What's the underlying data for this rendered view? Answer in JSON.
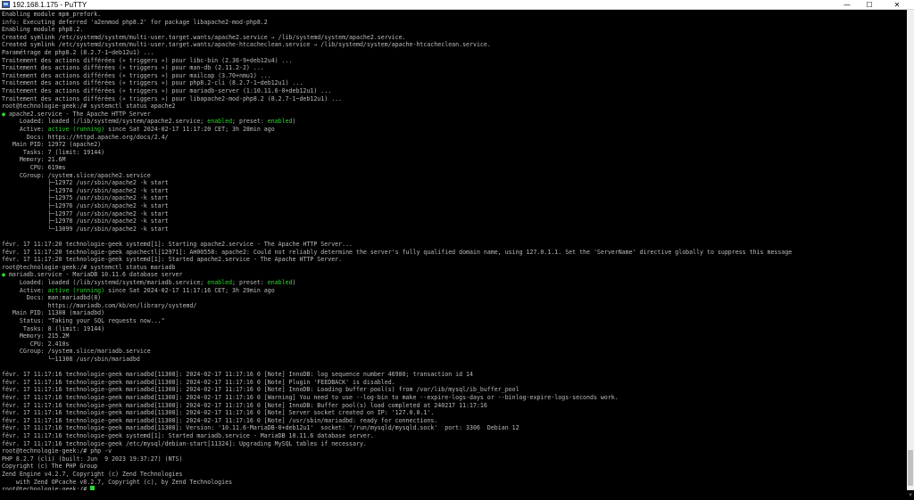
{
  "window": {
    "title": "192.168.1.175 - PuTTY",
    "controls": {
      "minimize": "—",
      "maximize": "☐",
      "close": "✕"
    }
  },
  "terminal": {
    "lines": [
      [
        {
          "t": "Enabling module mpm_prefork."
        }
      ],
      [
        {
          "t": "info: Executing deferred 'a2enmod php8.2' for package libapache2-mod-php8.2"
        }
      ],
      [
        {
          "t": "Enabling module php8.2."
        }
      ],
      [
        {
          "t": "Created symlink /etc/systemd/system/multi-user.target.wants/apache2.service → /lib/systemd/system/apache2.service."
        }
      ],
      [
        {
          "t": "Created symlink /etc/systemd/system/multi-user.target.wants/apache-htcacheclean.service → /lib/systemd/system/apache-htcacheclean.service."
        }
      ],
      [
        {
          "t": "Paramétrage de php8.2 (8.2.7-1~deb12u1) ..."
        }
      ],
      [
        {
          "t": "Traitement des actions différées (« triggers ») pour libc-bin (2.36-9+deb12u4) ..."
        }
      ],
      [
        {
          "t": "Traitement des actions différées (« triggers ») pour man-db (2.11.2-2) ..."
        }
      ],
      [
        {
          "t": "Traitement des actions différées (« triggers ») pour mailcap (3.70+nmu1) ..."
        }
      ],
      [
        {
          "t": "Traitement des actions différées (« triggers ») pour php8.2-cli (8.2.7-1~deb12u1) ..."
        }
      ],
      [
        {
          "t": "Traitement des actions différées (« triggers ») pour mariadb-server (1:10.11.6-0+deb12u1) ..."
        }
      ],
      [
        {
          "t": "Traitement des actions différées (« triggers ») pour libapache2-mod-php8.2 (8.2.7-1~deb12u1) ..."
        }
      ],
      [
        {
          "t": "root@technologie-geek:/# systemctl status apache2"
        }
      ],
      [
        {
          "t": "●",
          "c": "g"
        },
        {
          "t": " apache2.service - The Apache HTTP Server"
        }
      ],
      [
        {
          "t": "     Loaded: loaded (/lib/systemd/system/apache2.service; "
        },
        {
          "t": "enabled",
          "c": "g"
        },
        {
          "t": "; preset: "
        },
        {
          "t": "enabled",
          "c": "g"
        },
        {
          "t": ")"
        }
      ],
      [
        {
          "t": "     Active: "
        },
        {
          "t": "active (running)",
          "c": "g"
        },
        {
          "t": " since Sat 2024-02-17 11:17:20 CET; 3h 28min ago"
        }
      ],
      [
        {
          "t": "       Docs: https://httpd.apache.org/docs/2.4/"
        }
      ],
      [
        {
          "t": "   Main PID: 12972 (apache2)"
        }
      ],
      [
        {
          "t": "      Tasks: 7 (limit: 19144)"
        }
      ],
      [
        {
          "t": "     Memory: 21.6M"
        }
      ],
      [
        {
          "t": "        CPU: 619ms"
        }
      ],
      [
        {
          "t": "     CGroup: /system.slice/apache2.service"
        }
      ],
      [
        {
          "t": "             ├─12972 /usr/sbin/apache2 -k start"
        }
      ],
      [
        {
          "t": "             ├─12974 /usr/sbin/apache2 -k start"
        }
      ],
      [
        {
          "t": "             ├─12975 /usr/sbin/apache2 -k start"
        }
      ],
      [
        {
          "t": "             ├─12976 /usr/sbin/apache2 -k start"
        }
      ],
      [
        {
          "t": "             ├─12977 /usr/sbin/apache2 -k start"
        }
      ],
      [
        {
          "t": "             ├─12978 /usr/sbin/apache2 -k start"
        }
      ],
      [
        {
          "t": "             └─13099 /usr/sbin/apache2 -k start"
        }
      ],
      [
        {
          "t": ""
        }
      ],
      [
        {
          "t": "févr. 17 11:17:20 technologie-geek systemd[1]: Starting apache2.service - The Apache HTTP Server..."
        }
      ],
      [
        {
          "t": "févr. 17 11:17:20 technologie-geek apachectl[12971]: AH00558: apache2: Could not reliably determine the server's fully qualified domain name, using 127.0.1.1. Set the 'ServerName' directive globally to suppress this message"
        }
      ],
      [
        {
          "t": "févr. 17 11:17:20 technologie-geek systemd[1]: Started apache2.service - The Apache HTTP Server."
        }
      ],
      [
        {
          "t": "root@technologie-geek:/# systemctl status mariadb"
        }
      ],
      [
        {
          "t": "●",
          "c": "g"
        },
        {
          "t": " mariadb.service - MariaDB 10.11.6 database server"
        }
      ],
      [
        {
          "t": "     Loaded: loaded (/lib/systemd/system/mariadb.service; "
        },
        {
          "t": "enabled",
          "c": "g"
        },
        {
          "t": "; preset: "
        },
        {
          "t": "enabled",
          "c": "g"
        },
        {
          "t": ")"
        }
      ],
      [
        {
          "t": "     Active: "
        },
        {
          "t": "active (running)",
          "c": "g"
        },
        {
          "t": " since Sat 2024-02-17 11:17:16 CET; 3h 29min ago"
        }
      ],
      [
        {
          "t": "       Docs: man:mariadbd(8)"
        }
      ],
      [
        {
          "t": "             https://mariadb.com/kb/en/library/systemd/"
        }
      ],
      [
        {
          "t": "   Main PID: 11308 (mariadbd)"
        }
      ],
      [
        {
          "t": "     Status: \"Taking your SQL requests now...\""
        }
      ],
      [
        {
          "t": "      Tasks: 8 (limit: 19144)"
        }
      ],
      [
        {
          "t": "     Memory: 215.2M"
        }
      ],
      [
        {
          "t": "        CPU: 2.410s"
        }
      ],
      [
        {
          "t": "     CGroup: /system.slice/mariadb.service"
        }
      ],
      [
        {
          "t": "             └─11308 /usr/sbin/mariadbd"
        }
      ],
      [
        {
          "t": ""
        }
      ],
      [
        {
          "t": "févr. 17 11:17:16 technologie-geek mariadbd[11308]: 2024-02-17 11:17:16 0 [Note] InnoDB: log sequence number 46980; transaction id 14"
        }
      ],
      [
        {
          "t": "févr. 17 11:17:16 technologie-geek mariadbd[11308]: 2024-02-17 11:17:16 0 [Note] Plugin 'FEEDBACK' is disabled."
        }
      ],
      [
        {
          "t": "févr. 17 11:17:16 technologie-geek mariadbd[11308]: 2024-02-17 11:17:16 0 [Note] InnoDB: Loading buffer pool(s) from /var/lib/mysql/ib_buffer_pool"
        }
      ],
      [
        {
          "t": "févr. 17 11:17:16 technologie-geek mariadbd[11308]: 2024-02-17 11:17:16 0 [Warning] You need to use --log-bin to make --expire-logs-days or --binlog-expire-logs-seconds work."
        }
      ],
      [
        {
          "t": "févr. 17 11:17:16 technologie-geek mariadbd[11308]: 2024-02-17 11:17:16 0 [Note] InnoDB: Buffer pool(s) load completed at 240217 11:17:16"
        }
      ],
      [
        {
          "t": "févr. 17 11:17:16 technologie-geek mariadbd[11308]: 2024-02-17 11:17:16 0 [Note] Server socket created on IP: '127.0.0.1'."
        }
      ],
      [
        {
          "t": "févr. 17 11:17:16 technologie-geek mariadbd[11308]: 2024-02-17 11:17:16 0 [Note] /usr/sbin/mariadbd: ready for connections."
        }
      ],
      [
        {
          "t": "févr. 17 11:17:16 technologie-geek mariadbd[11308]: Version: '10.11.6-MariaDB-0+deb12u1'  socket: '/run/mysqld/mysqld.sock'  port: 3306  Debian 12"
        }
      ],
      [
        {
          "t": "févr. 17 11:17:16 technologie-geek systemd[1]: Started mariadb.service - MariaDB 10.11.6 database server."
        }
      ],
      [
        {
          "t": "févr. 17 11:17:16 technologie-geek /etc/mysql/debian-start[11324]: Upgrading MySQL tables if necessary."
        }
      ],
      [
        {
          "t": "root@technologie-geek:/# php -v"
        }
      ],
      [
        {
          "t": "PHP 8.2.7 (cli) (built: Jun  9 2023 19:37:27) (NTS)"
        }
      ],
      [
        {
          "t": "Copyright (c) The PHP Group"
        }
      ],
      [
        {
          "t": "Zend Engine v4.2.7, Copyright (c) Zend Technologies"
        }
      ],
      [
        {
          "t": "    with Zend OPcache v8.2.7, Copyright (c), by Zend Technologies"
        }
      ],
      [
        {
          "t": "root@technologie-geek:/# "
        },
        {
          "cursor": true
        }
      ]
    ]
  }
}
